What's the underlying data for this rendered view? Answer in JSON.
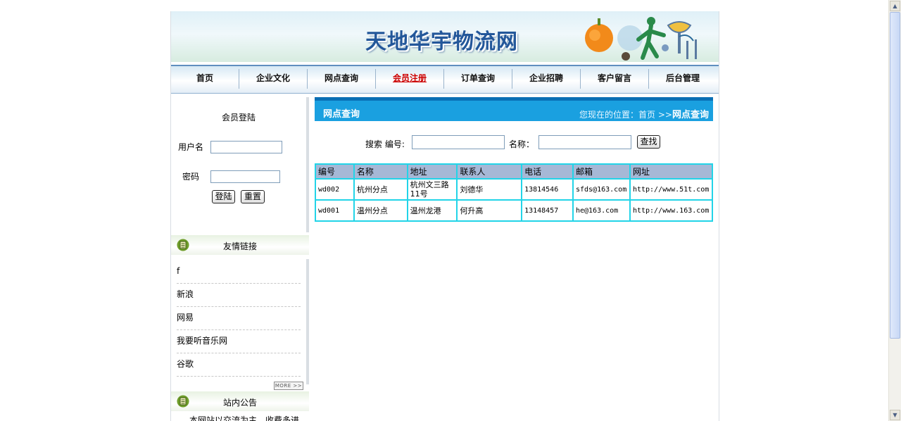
{
  "site": {
    "title": "天地华宇物流网"
  },
  "nav": {
    "items": [
      "首页",
      "企业文化",
      "网点查询",
      "会员注册",
      "订单查询",
      "企业招聘",
      "客户留言",
      "后台管理"
    ],
    "active_index": 3
  },
  "login": {
    "title": "会员登陆",
    "username_label": "用户名",
    "password_label": "密码",
    "username_value": "",
    "password_value": "",
    "login_button": "登陆",
    "reset_button": "重置"
  },
  "links_section": {
    "title": "友情链接",
    "items": [
      "f",
      "新浪",
      "网易",
      "我要听音乐网",
      "谷歌"
    ],
    "more_label": "MORE >>"
  },
  "notice_section": {
    "title": "站内公告",
    "text": "本网站以交流为主，收费多进"
  },
  "main": {
    "title": "网点查询",
    "location_prefix": "您现在的位置：首页 >>",
    "location_current": "网点查询",
    "search": {
      "label": "搜索 编号:",
      "name_label": "名称：",
      "id_value": "",
      "name_value": "",
      "button": "查找"
    },
    "table": {
      "headers": [
        "编号",
        "名称",
        "地址",
        "联系人",
        "电话",
        "邮箱",
        "网址"
      ],
      "rows": [
        [
          "wd002",
          "杭州分点",
          "杭州文三路11号",
          "刘德华",
          "13814546",
          "sfds@163.com",
          "http://www.51t.com"
        ],
        [
          "wd001",
          "温州分点",
          "温州龙港",
          "何升高",
          "13148457",
          "he@163.com",
          "http://www.163.com"
        ]
      ]
    }
  },
  "colors": {
    "nav_border": "#5f8fbf",
    "main_bar": "#1aa0e0",
    "table_border": "#22d4e8",
    "table_header": "#a6b8d6",
    "active_nav": "#cc0000"
  },
  "icons": [
    "book-icon",
    "scroll-up-arrow",
    "scroll-down-arrow"
  ]
}
